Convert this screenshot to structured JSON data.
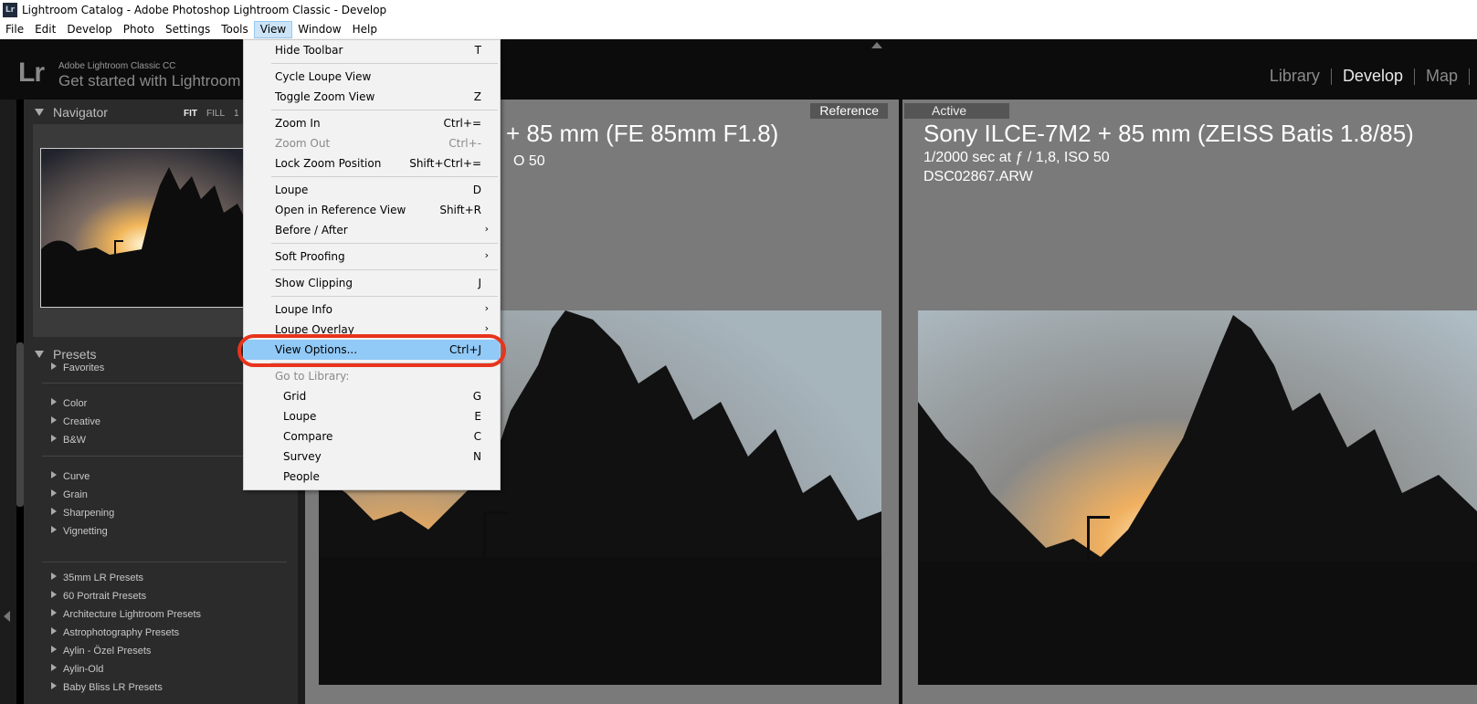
{
  "window": {
    "title": "Lightroom Catalog - Adobe Photoshop Lightroom Classic - Develop",
    "icon_text": "Lr"
  },
  "menubar": [
    "File",
    "Edit",
    "Develop",
    "Photo",
    "Settings",
    "Tools",
    "View",
    "Window",
    "Help"
  ],
  "header": {
    "logo": "Lr",
    "product": "Adobe Lightroom Classic CC",
    "tagline": "Get started with Lightroom",
    "modules": [
      "Library",
      "Develop",
      "Map"
    ],
    "active_module": "Develop"
  },
  "navigator": {
    "title": "Navigator",
    "options": [
      "FIT",
      "FILL",
      "1"
    ]
  },
  "presets": {
    "title": "Presets",
    "groups": [
      [
        "Favorites"
      ],
      [
        "Color",
        "Creative",
        "B&W"
      ],
      [
        "Curve",
        "Grain",
        "Sharpening",
        "Vignetting"
      ],
      [
        "35mm LR Presets",
        "60 Portrait Presets",
        "Architecture Lightroom Presets",
        "Astrophotography Presets",
        "Aylin - Özel Presets",
        "Aylin-Old",
        "Baby Bliss LR Presets"
      ]
    ]
  },
  "reference": {
    "badge": "Reference",
    "title": "+ 85 mm (FE 85mm F1.8)",
    "info": "O 50"
  },
  "active": {
    "badge": "Active",
    "title": "Sony ILCE-7M2 + 85 mm (ZEISS Batis 1.8/85)",
    "exposure": "1/2000 sec at ƒ / 1,8, ISO 50",
    "filename": "DSC02867.ARW"
  },
  "view_menu": {
    "items": [
      {
        "label": "Hide Toolbar",
        "shortcut": "T"
      },
      {
        "label": "Cycle Loupe View",
        "shortcut": ""
      },
      {
        "label": "Toggle Zoom View",
        "shortcut": "Z"
      },
      {
        "label": "Zoom In",
        "shortcut": "Ctrl+="
      },
      {
        "label": "Zoom Out",
        "shortcut": "Ctrl+-"
      },
      {
        "label": "Lock Zoom Position",
        "shortcut": "Shift+Ctrl+="
      },
      {
        "label": "Loupe",
        "shortcut": "D"
      },
      {
        "label": "Open in Reference View",
        "shortcut": "Shift+R"
      },
      {
        "label": "Before / After",
        "shortcut": ""
      },
      {
        "label": "Soft Proofing",
        "shortcut": ""
      },
      {
        "label": "Show Clipping",
        "shortcut": "J"
      },
      {
        "label": "Loupe Info",
        "shortcut": ""
      },
      {
        "label": "Loupe Overlay",
        "shortcut": ""
      },
      {
        "label": "View Options...",
        "shortcut": "Ctrl+J"
      },
      {
        "label": "Go to Library:",
        "shortcut": ""
      },
      {
        "label": "Grid",
        "shortcut": "G"
      },
      {
        "label": "Loupe",
        "shortcut": "E"
      },
      {
        "label": "Compare",
        "shortcut": "C"
      },
      {
        "label": "Survey",
        "shortcut": "N"
      },
      {
        "label": "People",
        "shortcut": ""
      }
    ]
  },
  "colors": {
    "highlight": "#91c9f7",
    "annotation": "#e8341c",
    "panel": "#2b2b2b",
    "view_bg": "#7a7a7a"
  }
}
